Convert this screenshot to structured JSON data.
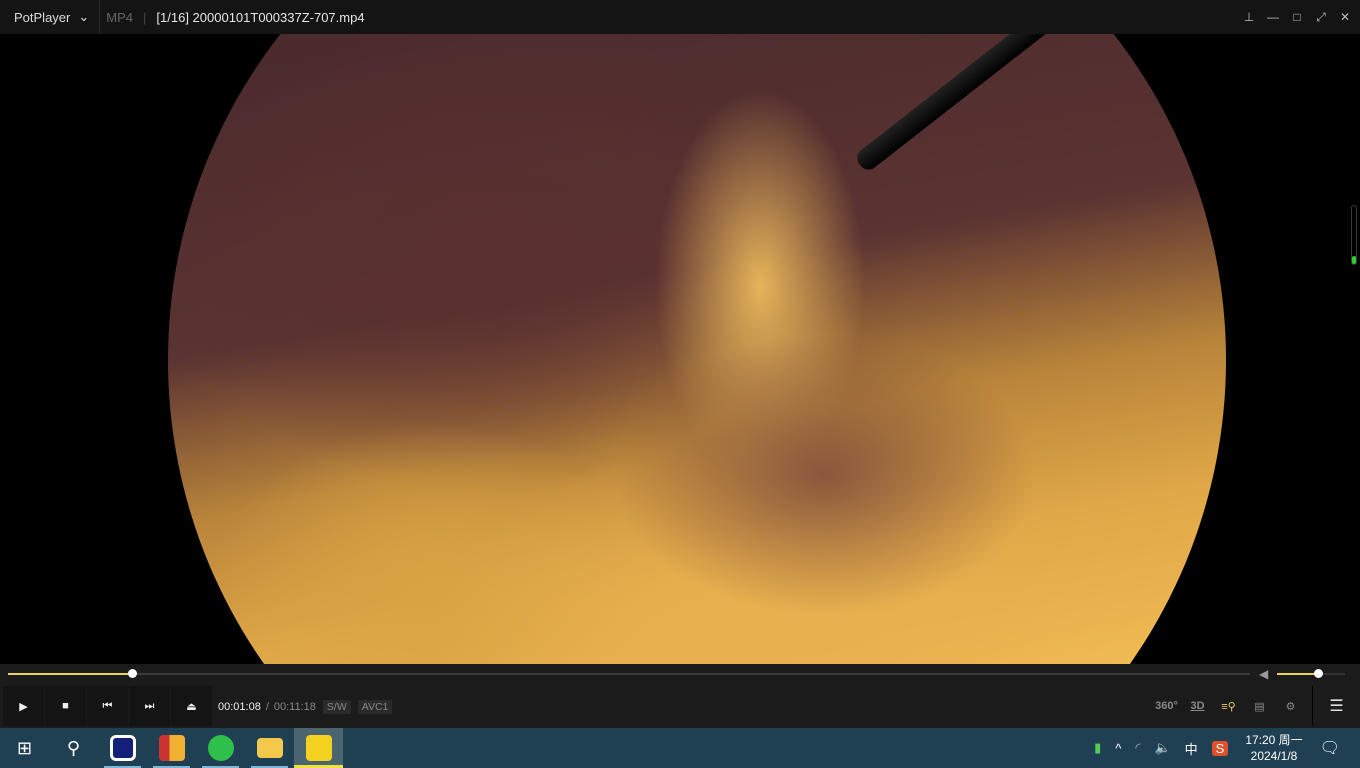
{
  "titlebar": {
    "app_name": "PotPlayer",
    "format": "MP4",
    "file_title": "[1/16] 20000101T000337Z-707.mp4"
  },
  "playback": {
    "current_time": "00:01:08",
    "separator": "/",
    "duration": "00:11:18",
    "renderer": "S/W",
    "codec": "AVC1",
    "progress_percent": 10,
    "volume_percent": 60
  },
  "controls": {
    "right_labels": {
      "vr": "360°",
      "stereo": "3D"
    }
  },
  "taskbar": {
    "clock_time": "17:20 周一",
    "clock_date": "2024/1/8",
    "ime": "中"
  }
}
